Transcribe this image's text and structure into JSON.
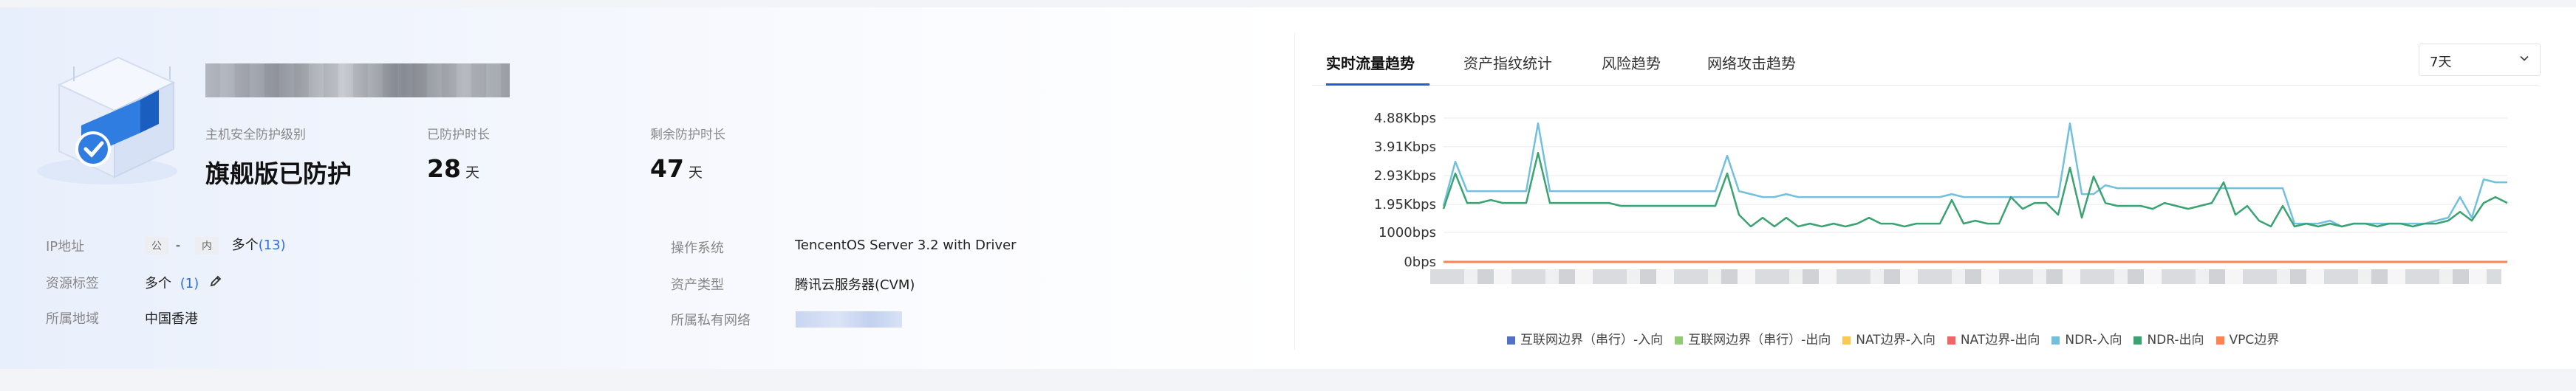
{
  "host": {
    "stats": [
      {
        "label": "主机安全防护级别",
        "value": "旗舰版已防护",
        "unit": ""
      },
      {
        "label": "已防护时长",
        "value": "28",
        "unit": "天"
      },
      {
        "label": "剩余防护时长",
        "value": "47",
        "unit": "天"
      }
    ],
    "info": {
      "ip_label": "IP地址",
      "ip_public_tag": "公",
      "ip_public_value": "-",
      "ip_private_tag": "内",
      "ip_private_value": "多个",
      "ip_private_count": "(13)",
      "tags_label": "资源标签",
      "tags_value": "多个",
      "tags_count": "(1)",
      "region_label": "所属地域",
      "region_value": "中国香港",
      "os_label": "操作系统",
      "os_value": "TencentOS Server 3.2 with Driver",
      "asset_type_label": "资产类型",
      "asset_type_value": "腾讯云服务器(CVM)",
      "vpc_label": "所属私有网络"
    }
  },
  "tabs": [
    "实时流量趋势",
    "资产指纹统计",
    "风险趋势",
    "网络攻击趋势"
  ],
  "time_range": {
    "selected": "7天"
  },
  "icons": {
    "edit": "pencil-icon",
    "select": "chevron-down-icon",
    "hero": "shield-server-icon"
  },
  "chart_data": {
    "type": "line",
    "y_ticks": [
      "0bps",
      "1000bps",
      "1.95Kbps",
      "2.93Kbps",
      "3.91Kbps",
      "4.88Kbps"
    ],
    "ylim": [
      0,
      4.88
    ],
    "y_unit": "Kbps",
    "grid": true,
    "legend_position": "bottom",
    "series": [
      {
        "name": "互联网边界（串行）-入向",
        "color": "#5470c6",
        "values": [
          0,
          0,
          0,
          0,
          0,
          0,
          0,
          0,
          0,
          0,
          0,
          0,
          0,
          0,
          0,
          0,
          0,
          0,
          0,
          0,
          0,
          0,
          0,
          0,
          0,
          0,
          0,
          0,
          0,
          0,
          0,
          0,
          0,
          0,
          0,
          0,
          0,
          0,
          0,
          0,
          0,
          0,
          0,
          0,
          0,
          0,
          0,
          0,
          0,
          0,
          0,
          0,
          0,
          0,
          0,
          0,
          0,
          0,
          0,
          0,
          0,
          0,
          0,
          0,
          0,
          0,
          0,
          0,
          0,
          0,
          0,
          0,
          0,
          0,
          0,
          0,
          0,
          0,
          0,
          0,
          0,
          0,
          0,
          0,
          0,
          0,
          0,
          0,
          0,
          0,
          0
        ]
      },
      {
        "name": "互联网边界（串行）-出向",
        "color": "#91cc75",
        "values": [
          0,
          0,
          0,
          0,
          0,
          0,
          0,
          0,
          0,
          0,
          0,
          0,
          0,
          0,
          0,
          0,
          0,
          0,
          0,
          0,
          0,
          0,
          0,
          0,
          0,
          0,
          0,
          0,
          0,
          0,
          0,
          0,
          0,
          0,
          0,
          0,
          0,
          0,
          0,
          0,
          0,
          0,
          0,
          0,
          0,
          0,
          0,
          0,
          0,
          0,
          0,
          0,
          0,
          0,
          0,
          0,
          0,
          0,
          0,
          0,
          0,
          0,
          0,
          0,
          0,
          0,
          0,
          0,
          0,
          0,
          0,
          0,
          0,
          0,
          0,
          0,
          0,
          0,
          0,
          0,
          0,
          0,
          0,
          0,
          0,
          0,
          0,
          0,
          0,
          0,
          0
        ]
      },
      {
        "name": "NAT边界-入向",
        "color": "#fac858",
        "values": [
          0,
          0,
          0,
          0,
          0,
          0,
          0,
          0,
          0,
          0,
          0,
          0,
          0,
          0,
          0,
          0,
          0,
          0,
          0,
          0,
          0,
          0,
          0,
          0,
          0,
          0,
          0,
          0,
          0,
          0,
          0,
          0,
          0,
          0,
          0,
          0,
          0,
          0,
          0,
          0,
          0,
          0,
          0,
          0,
          0,
          0,
          0,
          0,
          0,
          0,
          0,
          0,
          0,
          0,
          0,
          0,
          0,
          0,
          0,
          0,
          0,
          0,
          0,
          0,
          0,
          0,
          0,
          0,
          0,
          0,
          0,
          0,
          0,
          0,
          0,
          0,
          0,
          0,
          0,
          0,
          0,
          0,
          0,
          0,
          0,
          0,
          0,
          0,
          0,
          0,
          0
        ]
      },
      {
        "name": "NAT边界-出向",
        "color": "#ee6666",
        "values": [
          0,
          0,
          0,
          0,
          0,
          0,
          0,
          0,
          0,
          0,
          0,
          0,
          0,
          0,
          0,
          0,
          0,
          0,
          0,
          0,
          0,
          0,
          0,
          0,
          0,
          0,
          0,
          0,
          0,
          0,
          0,
          0,
          0,
          0,
          0,
          0,
          0,
          0,
          0,
          0,
          0,
          0,
          0,
          0,
          0,
          0,
          0,
          0,
          0,
          0,
          0,
          0,
          0,
          0,
          0,
          0,
          0,
          0,
          0,
          0,
          0,
          0,
          0,
          0,
          0,
          0,
          0,
          0,
          0,
          0,
          0,
          0,
          0,
          0,
          0,
          0,
          0,
          0,
          0,
          0,
          0,
          0,
          0,
          0,
          0,
          0,
          0,
          0,
          0,
          0,
          0
        ]
      },
      {
        "name": "NDR-入向",
        "color": "#73c0de",
        "values": [
          1.9,
          3.4,
          2.4,
          2.4,
          2.4,
          2.4,
          2.4,
          2.4,
          4.7,
          2.4,
          2.4,
          2.4,
          2.4,
          2.4,
          2.4,
          2.4,
          2.4,
          2.4,
          2.4,
          2.4,
          2.4,
          2.4,
          2.4,
          2.4,
          3.6,
          2.4,
          2.3,
          2.2,
          2.2,
          2.3,
          2.2,
          2.2,
          2.2,
          2.2,
          2.2,
          2.2,
          2.2,
          2.2,
          2.2,
          2.2,
          2.2,
          2.2,
          2.2,
          2.3,
          2.2,
          2.2,
          2.2,
          2.2,
          2.2,
          2.2,
          2.2,
          2.2,
          2.2,
          4.7,
          2.3,
          2.3,
          2.6,
          2.5,
          2.5,
          2.5,
          2.5,
          2.5,
          2.5,
          2.5,
          2.5,
          2.5,
          2.5,
          2.5,
          2.5,
          2.5,
          2.5,
          2.5,
          1.3,
          1.3,
          1.3,
          1.4,
          1.2,
          1.3,
          1.3,
          1.3,
          1.3,
          1.3,
          1.3,
          1.3,
          1.4,
          1.5,
          2.2,
          1.5,
          2.8,
          2.7,
          2.7
        ]
      },
      {
        "name": "NDR-出向",
        "color": "#3ba272",
        "values": [
          1.8,
          3.0,
          2.0,
          2.0,
          2.1,
          2.0,
          2.0,
          2.0,
          3.7,
          2.0,
          2.0,
          2.0,
          2.0,
          2.0,
          2.0,
          1.9,
          1.9,
          1.9,
          1.9,
          1.9,
          1.9,
          1.9,
          1.9,
          1.9,
          3.0,
          1.6,
          1.2,
          1.5,
          1.2,
          1.5,
          1.2,
          1.3,
          1.2,
          1.3,
          1.2,
          1.3,
          1.5,
          1.3,
          1.3,
          1.2,
          1.3,
          1.3,
          1.3,
          2.1,
          1.3,
          1.4,
          1.3,
          1.3,
          2.2,
          1.8,
          2.0,
          2.0,
          1.6,
          3.2,
          1.5,
          2.9,
          2.0,
          1.9,
          1.9,
          1.9,
          1.8,
          2.0,
          1.9,
          1.8,
          1.9,
          2.0,
          2.7,
          1.6,
          1.9,
          1.4,
          1.2,
          1.9,
          1.2,
          1.3,
          1.2,
          1.3,
          1.2,
          1.3,
          1.3,
          1.2,
          1.3,
          1.3,
          1.2,
          1.3,
          1.3,
          1.4,
          1.7,
          1.4,
          2.0,
          2.2,
          2.0
        ]
      },
      {
        "name": "VPC边界",
        "color": "#fc8452",
        "values": [
          0,
          0,
          0,
          0,
          0,
          0,
          0,
          0,
          0,
          0,
          0,
          0,
          0,
          0,
          0,
          0,
          0,
          0,
          0,
          0,
          0,
          0,
          0,
          0,
          0,
          0,
          0,
          0,
          0,
          0,
          0,
          0,
          0,
          0,
          0,
          0,
          0,
          0,
          0,
          0,
          0,
          0,
          0,
          0,
          0,
          0,
          0,
          0,
          0,
          0,
          0,
          0,
          0,
          0,
          0,
          0,
          0,
          0,
          0,
          0,
          0,
          0,
          0,
          0,
          0,
          0,
          0,
          0,
          0,
          0,
          0,
          0,
          0,
          0,
          0,
          0,
          0,
          0,
          0,
          0,
          0,
          0,
          0,
          0,
          0,
          0,
          0,
          0,
          0,
          0,
          0
        ]
      }
    ]
  }
}
